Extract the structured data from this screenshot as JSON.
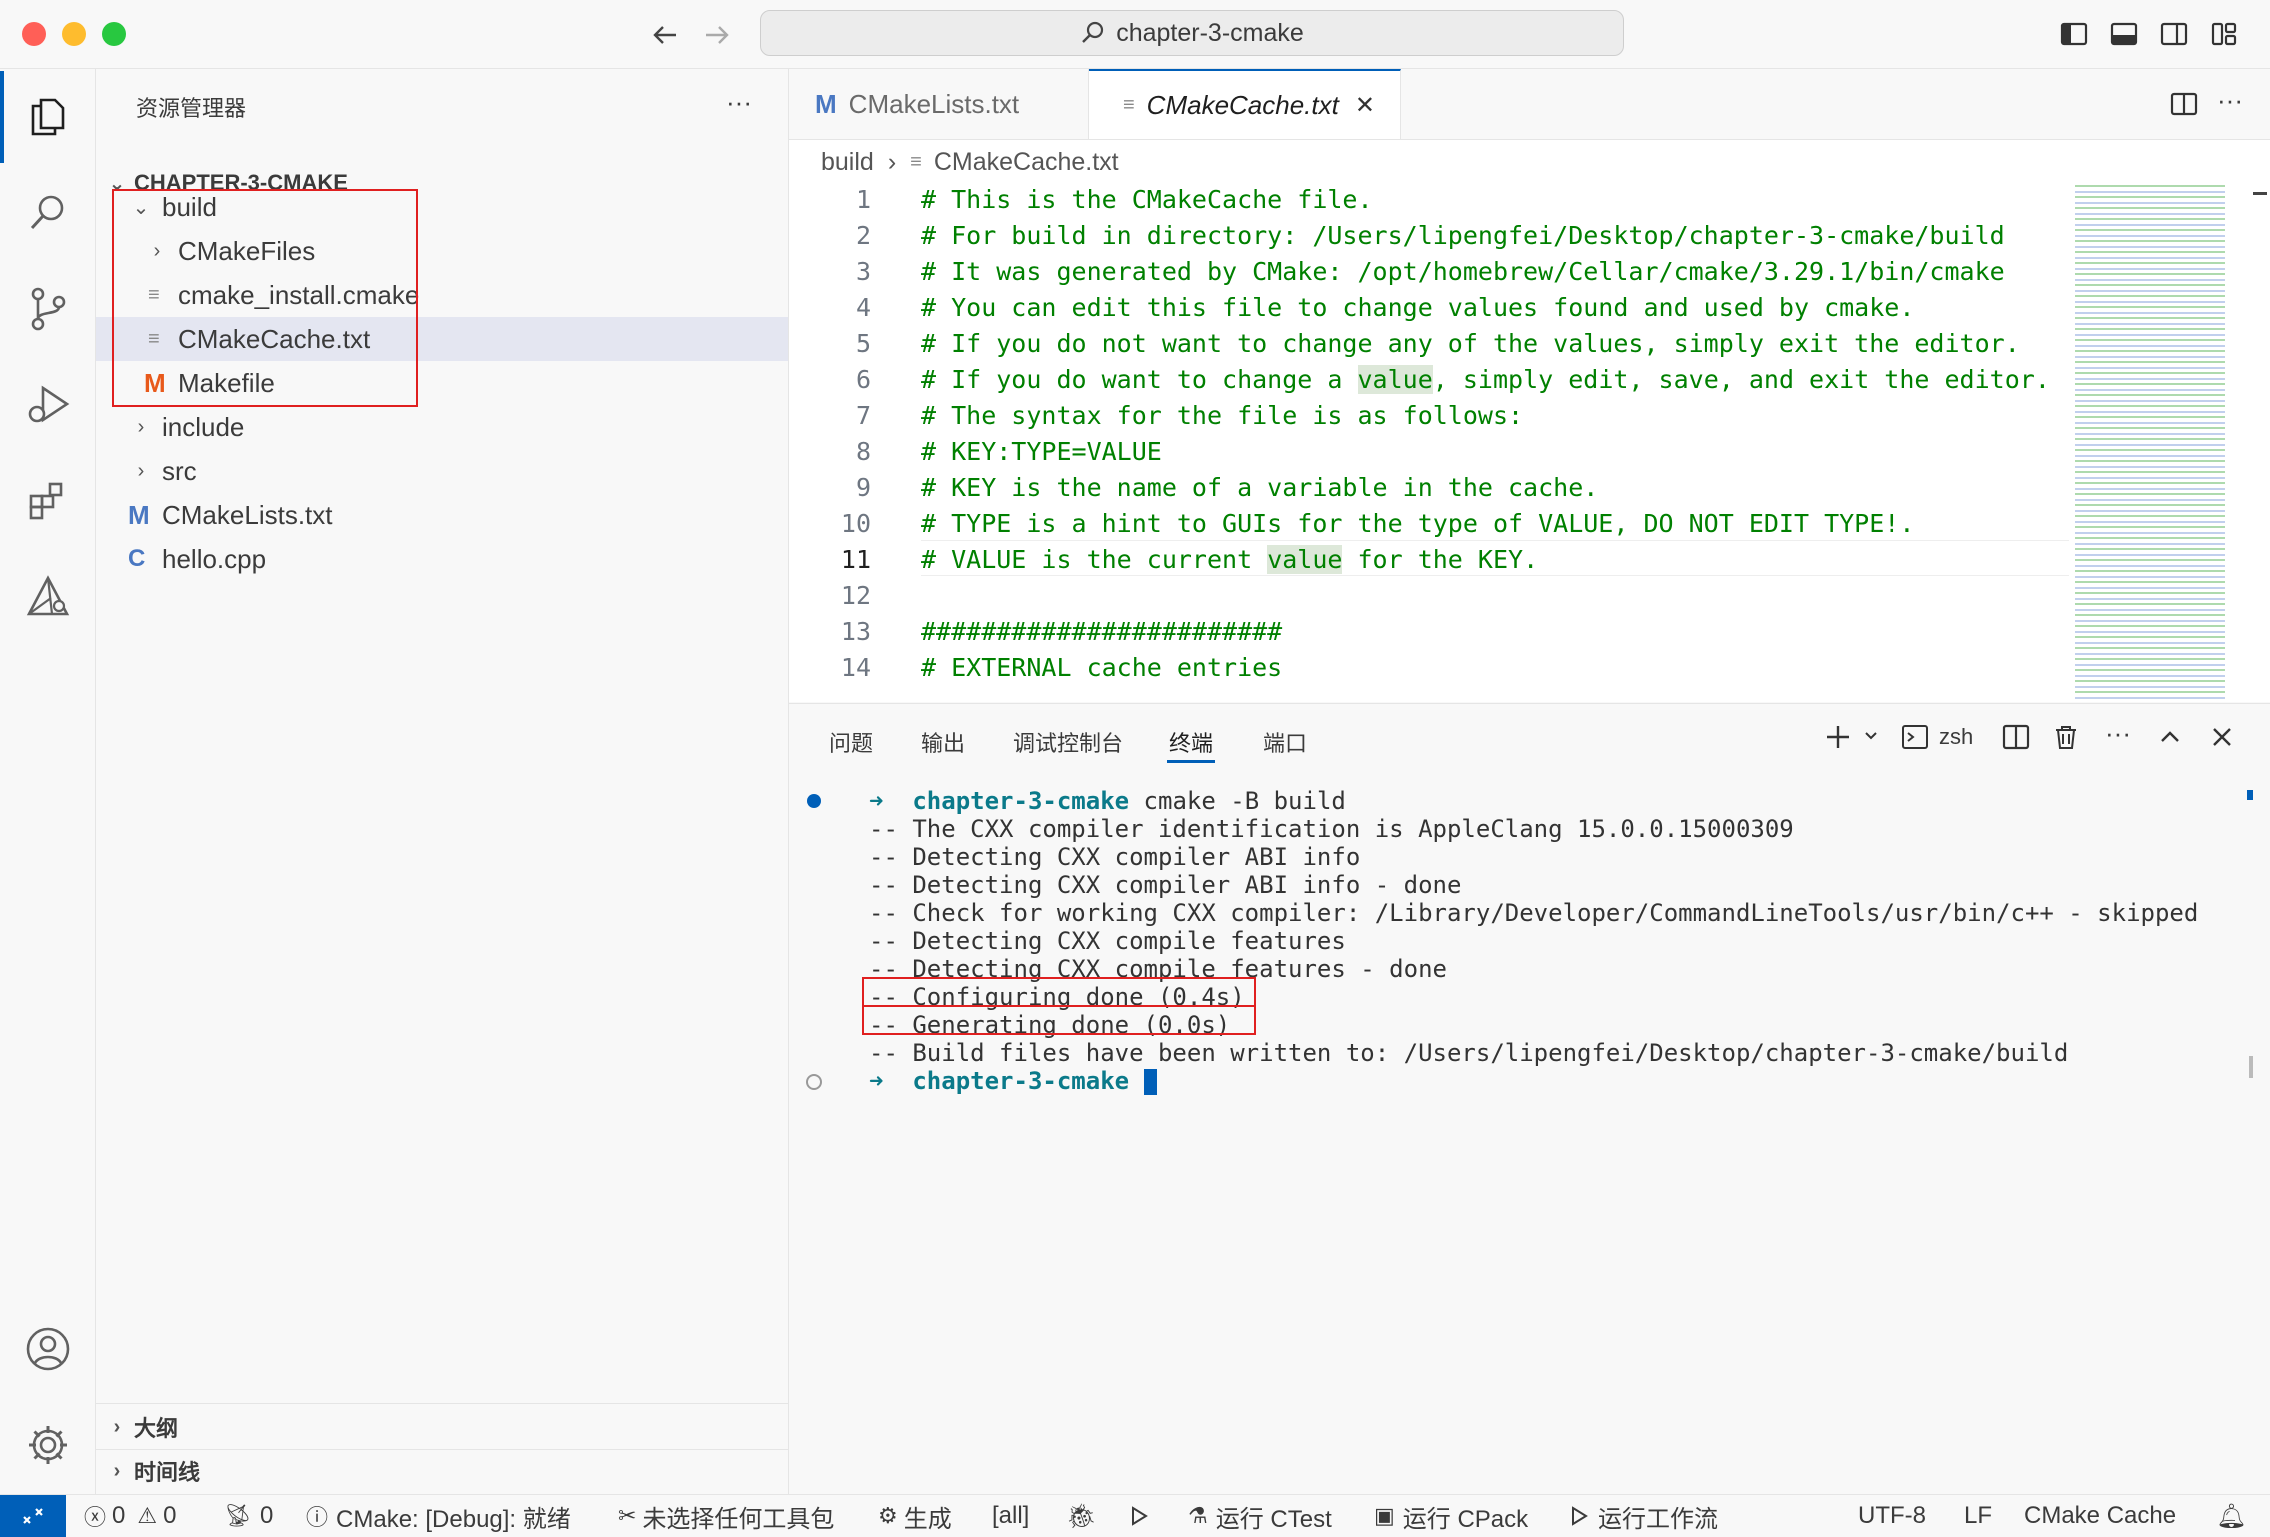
{
  "titlebar": {
    "search_text": "chapter-3-cmake"
  },
  "sidebar": {
    "title": "资源管理器",
    "more": "···",
    "project": "CHAPTER-3-CMAKE",
    "tree": [
      {
        "label": "build",
        "chevron": "⌄"
      },
      {
        "label": "CMakeFiles",
        "chevron": "›"
      },
      {
        "label": "cmake_install.cmake"
      },
      {
        "label": "CMakeCache.txt"
      },
      {
        "label": "Makefile",
        "icon": "M"
      },
      {
        "label": "include",
        "chevron": "›"
      },
      {
        "label": "src",
        "chevron": "›"
      },
      {
        "label": "CMakeLists.txt",
        "icon": "M"
      },
      {
        "label": "hello.cpp",
        "icon": "C"
      }
    ],
    "outline": "大纲",
    "timeline": "时间线"
  },
  "editor": {
    "tabs": [
      {
        "label": "CMakeLists.txt",
        "icon": "M"
      },
      {
        "label": "CMakeCache.txt",
        "close": "✕"
      }
    ],
    "breadcrumb": {
      "folder": "build",
      "sep": "›",
      "file": "CMakeCache.txt"
    },
    "lines": [
      {
        "n": "1",
        "text": "# This is the CMakeCache file."
      },
      {
        "n": "2",
        "text": "# For build in directory: /Users/lipengfei/Desktop/chapter-3-cmake/build"
      },
      {
        "n": "3",
        "text": "# It was generated by CMake: /opt/homebrew/Cellar/cmake/3.29.1/bin/cmake"
      },
      {
        "n": "4",
        "text": "# You can edit this file to change values found and used by cmake."
      },
      {
        "n": "5",
        "text": "# If you do not want to change any of the values, simply exit the editor."
      },
      {
        "n": "6",
        "text": "# If you do want to change a value, simply edit, save, and exit the editor."
      },
      {
        "n": "7",
        "text": "# The syntax for the file is as follows:"
      },
      {
        "n": "8",
        "text": "# KEY:TYPE=VALUE"
      },
      {
        "n": "9",
        "text": "# KEY is the name of a variable in the cache."
      },
      {
        "n": "10",
        "text": "# TYPE is a hint to GUIs for the type of VALUE, DO NOT EDIT TYPE!."
      },
      {
        "n": "11",
        "text": "# VALUE is the current value for the KEY."
      },
      {
        "n": "12",
        "text": ""
      },
      {
        "n": "13",
        "text": "########################"
      },
      {
        "n": "14",
        "text": "# EXTERNAL cache entries"
      }
    ]
  },
  "panel": {
    "tabs": [
      "问题",
      "输出",
      "调试控制台",
      "终端",
      "端口"
    ],
    "shell": "zsh",
    "prompt_dir": "chapter-3-cmake",
    "command": " cmake -B build",
    "output": [
      "-- The CXX compiler identification is AppleClang 15.0.0.15000309",
      "-- Detecting CXX compiler ABI info",
      "-- Detecting CXX compiler ABI info - done",
      "-- Check for working CXX compiler: /Library/Developer/CommandLineTools/usr/bin/c++ - skipped",
      "-- Detecting CXX compile features",
      "-- Detecting CXX compile features - done",
      "-- Configuring done (0.4s)",
      "-- Generating done (0.0s)",
      "-- Build files have been written to: /Users/lipengfei/Desktop/chapter-3-cmake/build"
    ],
    "prompt_arrow": "➜"
  },
  "statusbar": {
    "errors": "0",
    "warnings": "0",
    "ports": "0",
    "cmake_status": "CMake: [Debug]: 就绪",
    "kit": "未选择任何工具包",
    "build": "生成",
    "target": "[all]",
    "ctest": "运行 CTest",
    "cpack": "运行 CPack",
    "workflow": "运行工作流",
    "encoding": "UTF-8",
    "eol": "LF",
    "language": "CMake Cache"
  },
  "colors": {
    "accent": "#005fb8",
    "highlight_box": "#e02020",
    "prompt": "#0b7a8a",
    "comment": "#008000"
  }
}
